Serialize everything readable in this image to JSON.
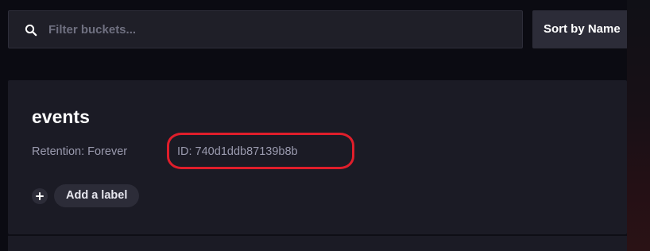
{
  "search": {
    "placeholder": "Filter buckets...",
    "value": ""
  },
  "sort": {
    "label": "Sort by Name"
  },
  "bucket": {
    "name": "events",
    "retention": "Retention: Forever",
    "id": "ID: 740d1ddb87139b8b",
    "add_label": "Add a label"
  },
  "colors": {
    "background": "#0b0b12",
    "card": "#1b1b25",
    "input": "#1f1f28",
    "button": "#2c2c38",
    "annotation": "#e01e2b"
  },
  "icons": {
    "search": "search-icon",
    "add": "plus-icon"
  }
}
